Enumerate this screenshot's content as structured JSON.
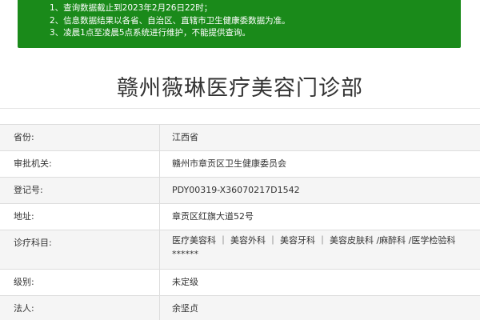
{
  "notice": {
    "lines": [
      "1、查询数据截止到2023年2月26日22时；",
      "2、信息数据结果以各省、自治区、直辖市卫生健康委数据为准。",
      "3、凌晨1点至凌晨5点系统进行维护，不能提供查询。"
    ]
  },
  "title": "赣州薇琳医疗美容门诊部",
  "fields": [
    {
      "label": "省份:",
      "value": "江西省"
    },
    {
      "label": "审批机关:",
      "value": "赣州市章贡区卫生健康委员会"
    },
    {
      "label": "登记号:",
      "value": "PDY00319-X36070217D1542"
    },
    {
      "label": "地址:",
      "value": "章贡区红旗大道52号"
    },
    {
      "label": "诊疗科目:",
      "value": "医疗美容科 ｜ 美容外科 ｜ 美容牙科 ｜ 美容皮肤科 /麻醉科 /医学检验科",
      "value_line2": "******"
    },
    {
      "label": "级别:",
      "value": "未定级"
    },
    {
      "label": "法人:",
      "value": "余坚贞"
    }
  ]
}
